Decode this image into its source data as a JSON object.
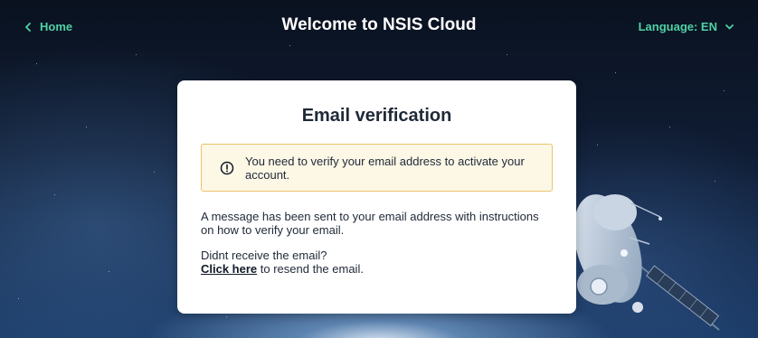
{
  "header": {
    "home_label": "Home",
    "title": "Welcome to NSIS Cloud",
    "language_label": "Language: EN"
  },
  "card": {
    "title": "Email verification",
    "alert_text": "You need to verify your email address to activate your account.",
    "message": "A message has been sent to your email address with instructions on how to verify your email.",
    "resend_question": "Didnt receive the email?",
    "resend_link": "Click here",
    "resend_suffix": " to resend the email."
  },
  "colors": {
    "accent": "#4fd1a5",
    "alert_background": "#fdf7e6",
    "alert_border": "#e9c46a",
    "card_background": "#ffffff"
  },
  "icons": {
    "home": "chevron-left-icon",
    "language": "chevron-down-icon",
    "alert": "exclamation-circle-icon"
  }
}
